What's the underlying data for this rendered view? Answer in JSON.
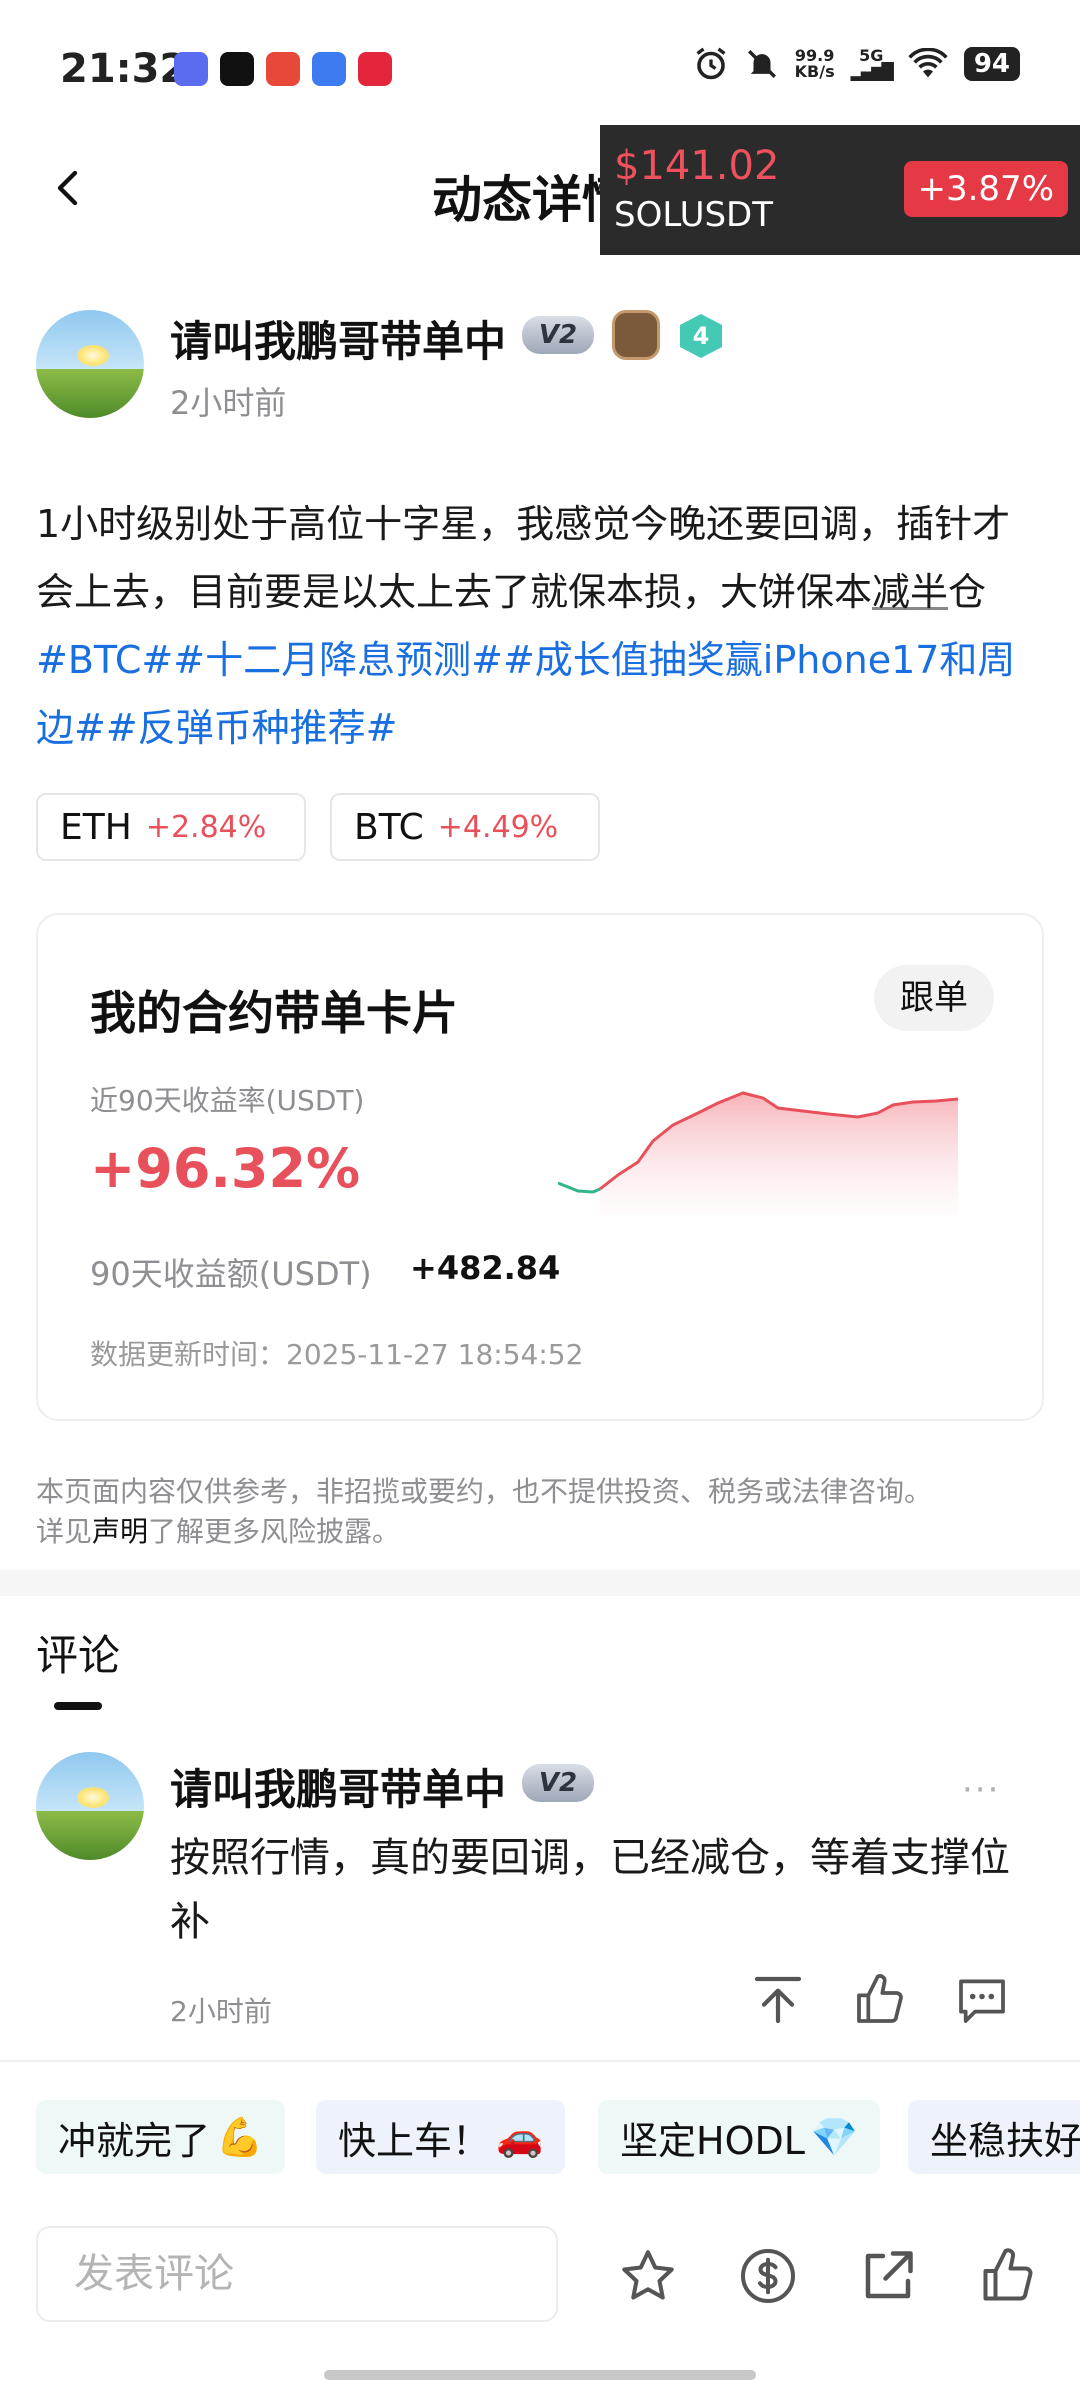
{
  "status_bar": {
    "time": "21:32",
    "net_speed_value": "99.9",
    "net_speed_unit": "KB/s",
    "signal": "5G",
    "battery": "94"
  },
  "header": {
    "title": "动态详情",
    "ticker": {
      "price": "$141.02",
      "pair": "SOLUSDT",
      "change": "+3.87%"
    }
  },
  "author": {
    "name": "请叫我鹏哥带单中",
    "badge": "V2",
    "level": "4",
    "time": "2小时前"
  },
  "post": {
    "text_1": "1小时级别处于高位十字星，我感觉今晚还要回调，插针才会上去，目前要是以太上去了就保本损，大饼保本",
    "text_2": "减半",
    "text_3": "仓",
    "tags": [
      "#BTC#",
      "#十二月降息预测#",
      "#成长值抽奖赢iPhone17和周边#",
      "#反弹币种推荐#"
    ]
  },
  "coins": [
    {
      "symbol": "ETH",
      "change": "+2.84%"
    },
    {
      "symbol": "BTC",
      "change": "+4.49%"
    }
  ],
  "card": {
    "title": "我的合约带单卡片",
    "follow_label": "跟单",
    "roi_label": "近90天收益率(USDT)",
    "roi_value": "+96.32%",
    "pnl_label": "90天收益额(USDT)",
    "pnl_value": "+482.84",
    "updated_label": "数据更新时间：",
    "updated_value": "2025-11-27 18:54:52",
    "line_color": "#e8505b",
    "negative_color": "#2fb58a"
  },
  "disclaimer": {
    "text_1": "本页面内容仅供参考，非招揽或要约，也不提供投资、税务或法律咨询。",
    "text_2": "详见",
    "link": "声明",
    "text_3": "了解更多风险披露。"
  },
  "comments_tab": "评论",
  "comment": {
    "name": "请叫我鹏哥带单中",
    "badge": "V2",
    "text": "按照行情，真的要回调，已经减仓，等着支撑位补",
    "time": "2小时前",
    "more": "···"
  },
  "quick_replies": [
    {
      "label": "冲就完了",
      "emoji": "💪"
    },
    {
      "label": "快上车！",
      "emoji": "🚗"
    },
    {
      "label": "坚定HODL",
      "emoji": "💎"
    },
    {
      "label": "坐稳扶好",
      "emoji": ""
    }
  ],
  "bottom_bar": {
    "placeholder": "发表评论"
  },
  "icons": [
    "back-icon",
    "alarm-icon",
    "mute-icon",
    "wifi-icon",
    "pin-top-icon",
    "like-icon",
    "comment-icon",
    "star-icon",
    "tip-icon",
    "share-icon"
  ]
}
